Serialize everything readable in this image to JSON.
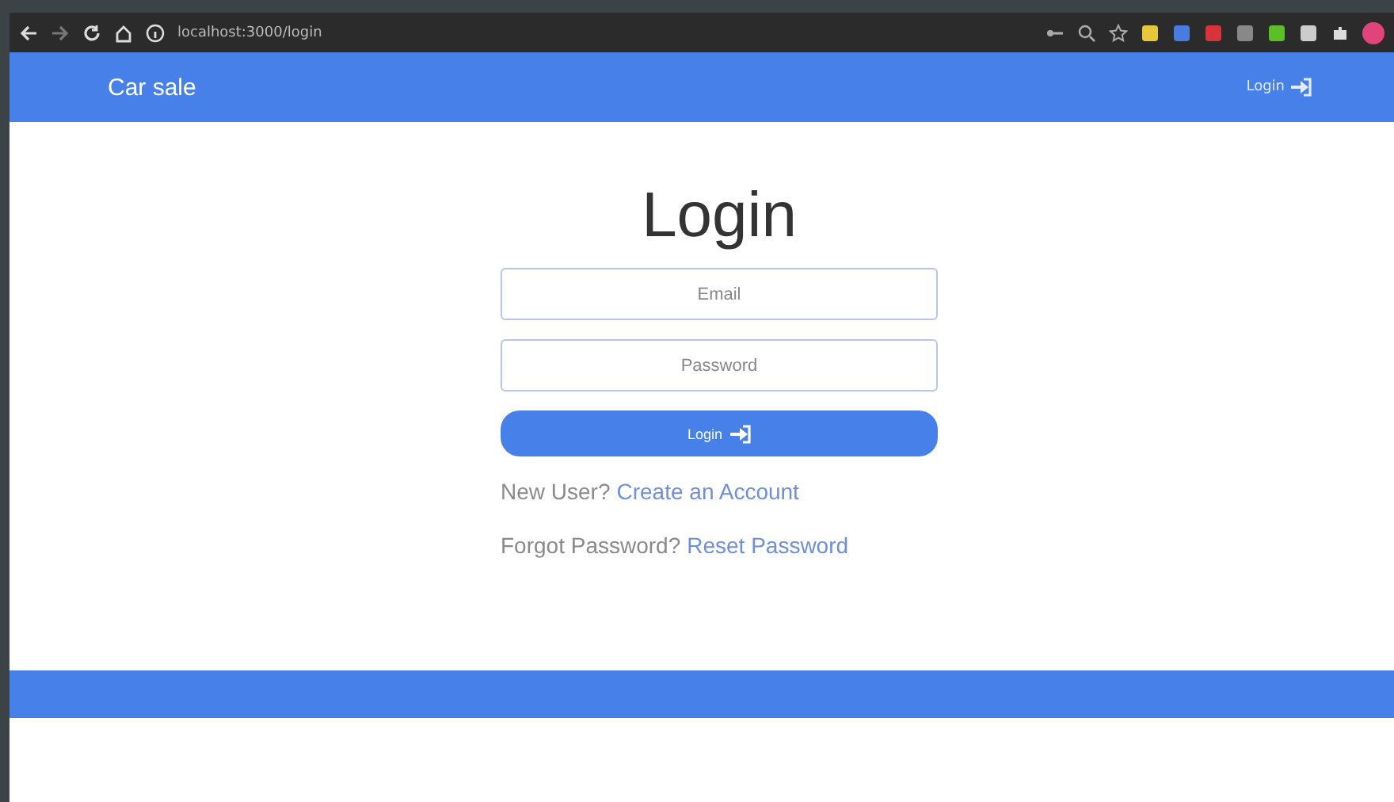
{
  "browser": {
    "url": "localhost:3000/login"
  },
  "navbar": {
    "brand": "Car sale",
    "login_link": "Login"
  },
  "form": {
    "title": "Login",
    "email": {
      "placeholder": "Email"
    },
    "password": {
      "placeholder": "Password"
    },
    "submit": "Login"
  },
  "links": [
    {
      "prompt": "New User?",
      "link": "Create an Account"
    },
    {
      "prompt": "Forgot Password?",
      "link": "Reset Password"
    }
  ]
}
